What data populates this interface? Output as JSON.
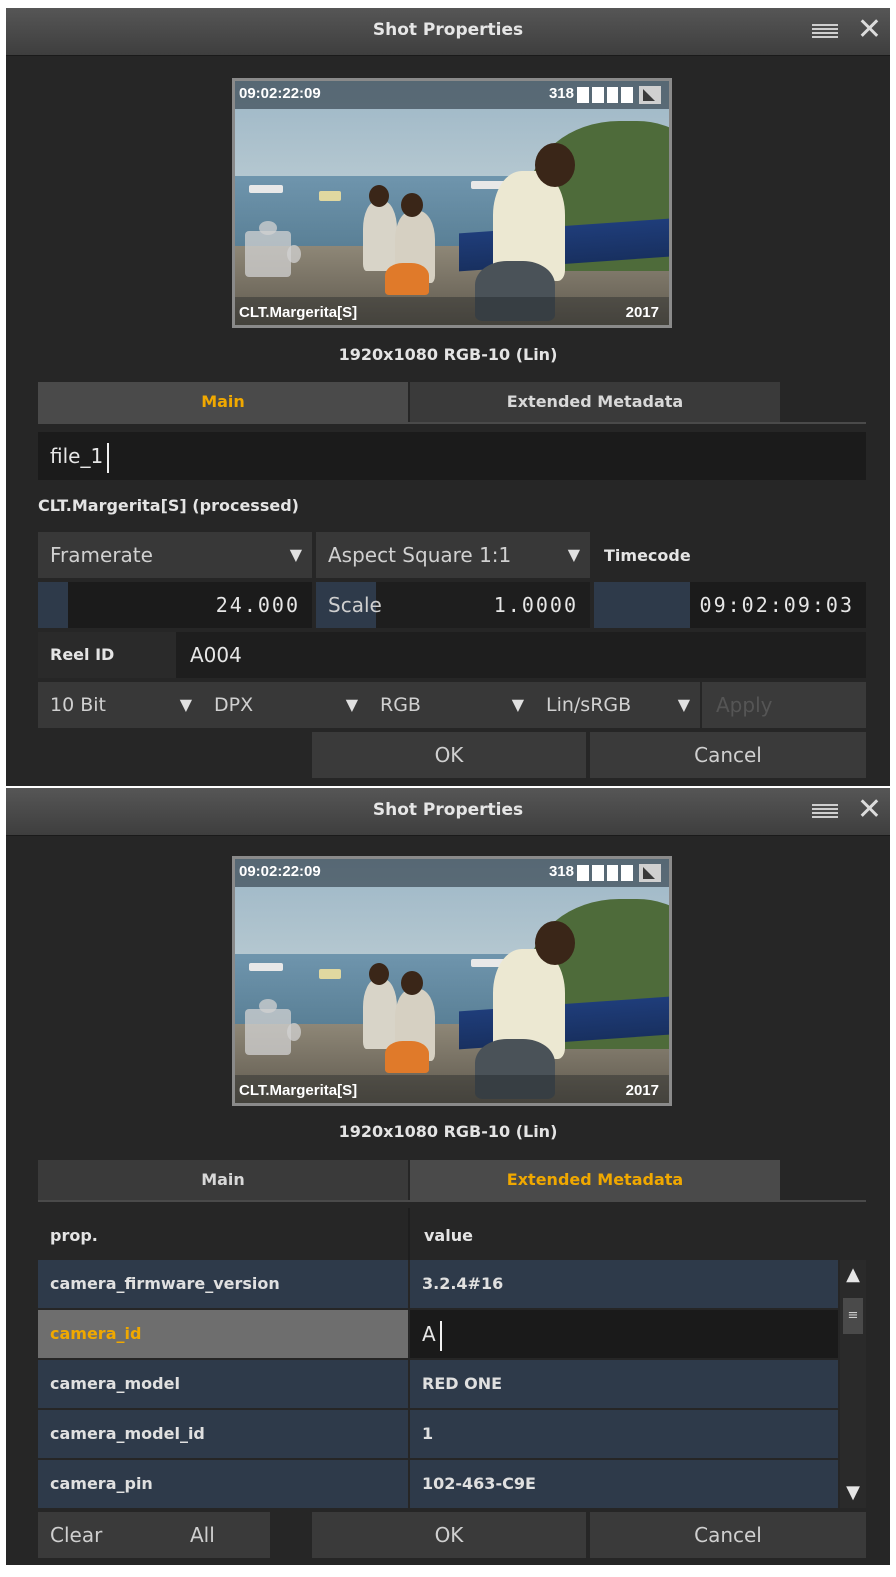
{
  "panel1": {
    "title": "Shot Properties",
    "thumbnail": {
      "timecode": "09:02:22:09",
      "frames": "318",
      "clip_name": "CLT.Margerita[S]",
      "year": "2017"
    },
    "resolution": "1920x1080 RGB-10 (Lin)",
    "tabs": {
      "main": "Main",
      "extended": "Extended Metadata",
      "active": "Main"
    },
    "name_value": "file_1",
    "source_label": "CLT.Margerita[S] (processed)",
    "framerate_label": "Framerate",
    "aspect_label": "Aspect Square 1:1",
    "timecode_label": "Timecode",
    "framerate_value": "24.000",
    "scale_label": "Scale",
    "scale_value": "1.0000",
    "timecode_value": "09:02:09:03",
    "reel_label": "Reel ID",
    "reel_value": "A004",
    "bit_depth": "10 Bit",
    "format": "DPX",
    "colorspace": "RGB",
    "lut": "Lin/sRGB",
    "apply_label": "Apply",
    "ok_label": "OK",
    "cancel_label": "Cancel"
  },
  "panel2": {
    "title": "Shot Properties",
    "thumbnail": {
      "timecode": "09:02:22:09",
      "frames": "318",
      "clip_name": "CLT.Margerita[S]",
      "year": "2017"
    },
    "resolution": "1920x1080 RGB-10 (Lin)",
    "tabs": {
      "main": "Main",
      "extended": "Extended Metadata",
      "active": "Extended Metadata"
    },
    "table_headers": {
      "prop": "prop.",
      "value": "value"
    },
    "rows": [
      {
        "prop": "camera_firmware_version",
        "value": "3.2.4#16"
      },
      {
        "prop": "camera_id",
        "value": "A"
      },
      {
        "prop": "camera_model",
        "value": "RED ONE"
      },
      {
        "prop": "camera_model_id",
        "value": "1"
      },
      {
        "prop": "camera_pin",
        "value": "102-463-C9E"
      }
    ],
    "clear_label": "Clear",
    "all_label": "All",
    "ok_label": "OK",
    "cancel_label": "Cancel"
  },
  "colors": {
    "accent": "#f0a800",
    "panel_bg": "#262626",
    "row_bg": "#2e3a4a"
  },
  "icons": {
    "menu": "menu-icon",
    "close": "close-icon",
    "dropdown": "dropdown-arrow-icon"
  }
}
